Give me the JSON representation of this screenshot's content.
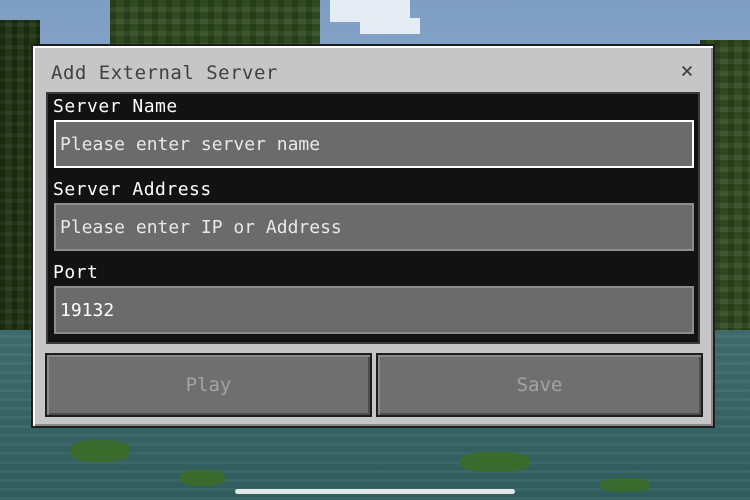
{
  "dialog": {
    "title": "Add External Server",
    "close_icon": "close-icon",
    "close_glyph": "×"
  },
  "fields": {
    "server_name": {
      "label": "Server Name",
      "placeholder": "Please enter server name",
      "value": ""
    },
    "server_address": {
      "label": "Server Address",
      "placeholder": "Please enter IP or Address",
      "value": ""
    },
    "port": {
      "label": "Port",
      "placeholder": "",
      "value": "19132"
    }
  },
  "buttons": {
    "play": "Play",
    "save": "Save"
  },
  "colors": {
    "dialog_bg": "#c6c6c6",
    "form_bg": "#121212",
    "input_bg": "#6b6b6b",
    "button_bg": "#6f6f6f",
    "disabled_text": "#a3a3a3"
  }
}
